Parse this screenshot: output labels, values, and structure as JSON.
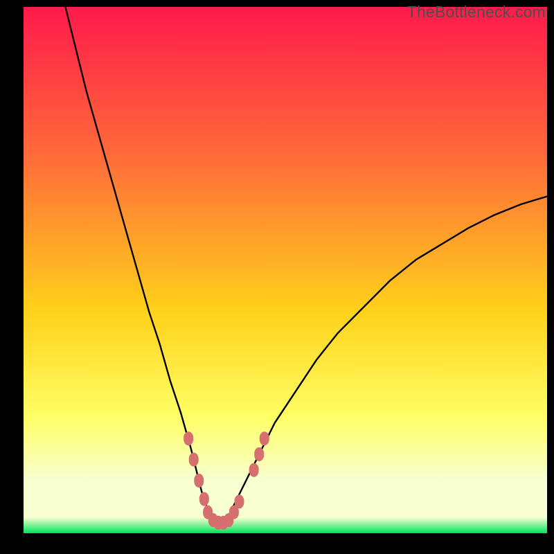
{
  "watermark": "TheBottleneck.com",
  "colors": {
    "gradient_top": "#ff1a4b",
    "gradient_mid_upper": "#ff6a3a",
    "gradient_mid": "#ffd21a",
    "gradient_mid_lower": "#ffff66",
    "gradient_pale": "#f8ffd0",
    "gradient_green": "#00e35b",
    "curve": "#000000",
    "marker": "#d6706f",
    "frame": "#000000"
  },
  "chart_data": {
    "type": "line",
    "title": "",
    "xlabel": "",
    "ylabel": "",
    "xlim": [
      0,
      100
    ],
    "ylim": [
      0,
      100
    ],
    "series": [
      {
        "name": "bottleneck-curve",
        "x": [
          8,
          10,
          12,
          14,
          16,
          18,
          20,
          22,
          24,
          26,
          28,
          30,
          32,
          33,
          34,
          35,
          36,
          37,
          38,
          39,
          40,
          42,
          45,
          48,
          52,
          56,
          60,
          65,
          70,
          75,
          80,
          85,
          90,
          95,
          100
        ],
        "y": [
          100,
          92,
          84,
          77,
          70,
          63,
          56,
          49,
          42,
          36,
          29,
          23,
          16,
          12,
          8,
          5,
          3,
          2,
          2,
          3,
          5,
          9,
          15,
          21,
          27,
          33,
          38,
          43,
          48,
          52,
          55,
          58,
          60.5,
          62.5,
          64
        ]
      }
    ],
    "markers": [
      {
        "name": "left-cluster",
        "points": [
          {
            "x": 31.5,
            "y": 18
          },
          {
            "x": 32.5,
            "y": 14
          },
          {
            "x": 33.5,
            "y": 10
          },
          {
            "x": 34.5,
            "y": 6.5
          },
          {
            "x": 35.2,
            "y": 4
          },
          {
            "x": 36.2,
            "y": 2.5
          },
          {
            "x": 37.2,
            "y": 2
          },
          {
            "x": 38.2,
            "y": 2
          },
          {
            "x": 39.2,
            "y": 2.5
          },
          {
            "x": 40.2,
            "y": 4
          },
          {
            "x": 41.2,
            "y": 6
          }
        ]
      },
      {
        "name": "right-cluster",
        "points": [
          {
            "x": 44.0,
            "y": 12
          },
          {
            "x": 45.0,
            "y": 15
          },
          {
            "x": 46.0,
            "y": 18
          }
        ]
      }
    ],
    "green_band": {
      "y_min": 0,
      "y_max": 3
    },
    "pale_band": {
      "y_min": 3,
      "y_max": 18
    }
  }
}
